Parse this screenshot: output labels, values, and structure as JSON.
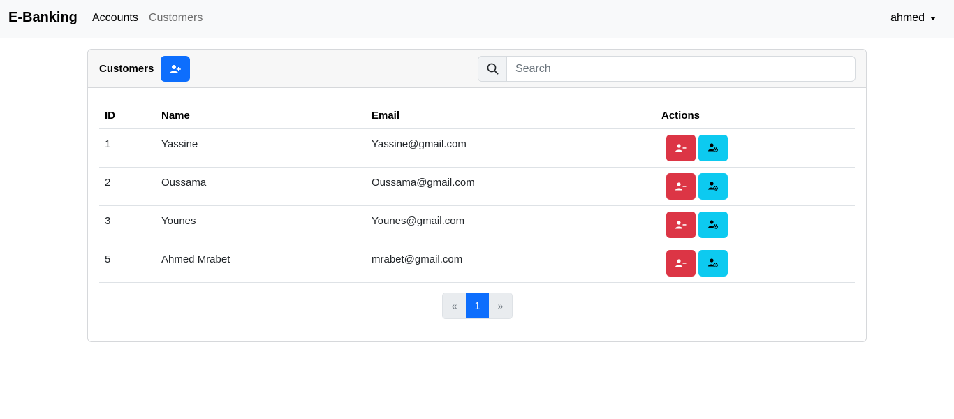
{
  "navbar": {
    "brand": "E-Banking",
    "links": [
      "Accounts",
      "Customers"
    ],
    "user": "ahmed"
  },
  "card": {
    "title": "Customers",
    "search": {
      "placeholder": "Search",
      "value": ""
    }
  },
  "table": {
    "headers": [
      "ID",
      "Name",
      "Email",
      "Actions"
    ],
    "rows": [
      {
        "id": "1",
        "name": "Yassine",
        "email": "Yassine@gmail.com"
      },
      {
        "id": "2",
        "name": "Oussama",
        "email": "Oussama@gmail.com"
      },
      {
        "id": "3",
        "name": "Younes",
        "email": "Younes@gmail.com"
      },
      {
        "id": "5",
        "name": "Ahmed Mrabet",
        "email": "mrabet@gmail.com"
      }
    ]
  },
  "pagination": {
    "prev": "«",
    "current": "1",
    "next": "»"
  },
  "icons": {
    "add": "user-plus-icon",
    "search": "search-icon",
    "delete": "user-minus-icon",
    "edit": "user-gear-icon"
  },
  "colors": {
    "primary": "#0d6efd",
    "danger": "#dc3545",
    "info": "#0dcaf0"
  }
}
